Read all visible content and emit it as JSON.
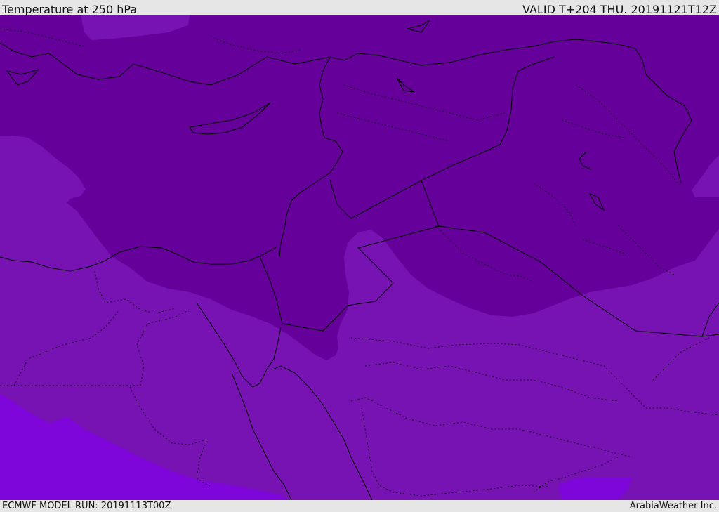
{
  "header": {
    "title": "Temperature at 250 hPa",
    "valid_time": "VALID T+204 THU. 20191121T12Z"
  },
  "footer": {
    "model_run": "ECMWF MODEL RUN: 20191113T00Z",
    "credit": "ArabiaWeather Inc."
  },
  "map": {
    "colors": {
      "cold_core": "#65009a",
      "mid": "#7813b3",
      "warm": "#7f06db",
      "coast": "#000000"
    }
  }
}
